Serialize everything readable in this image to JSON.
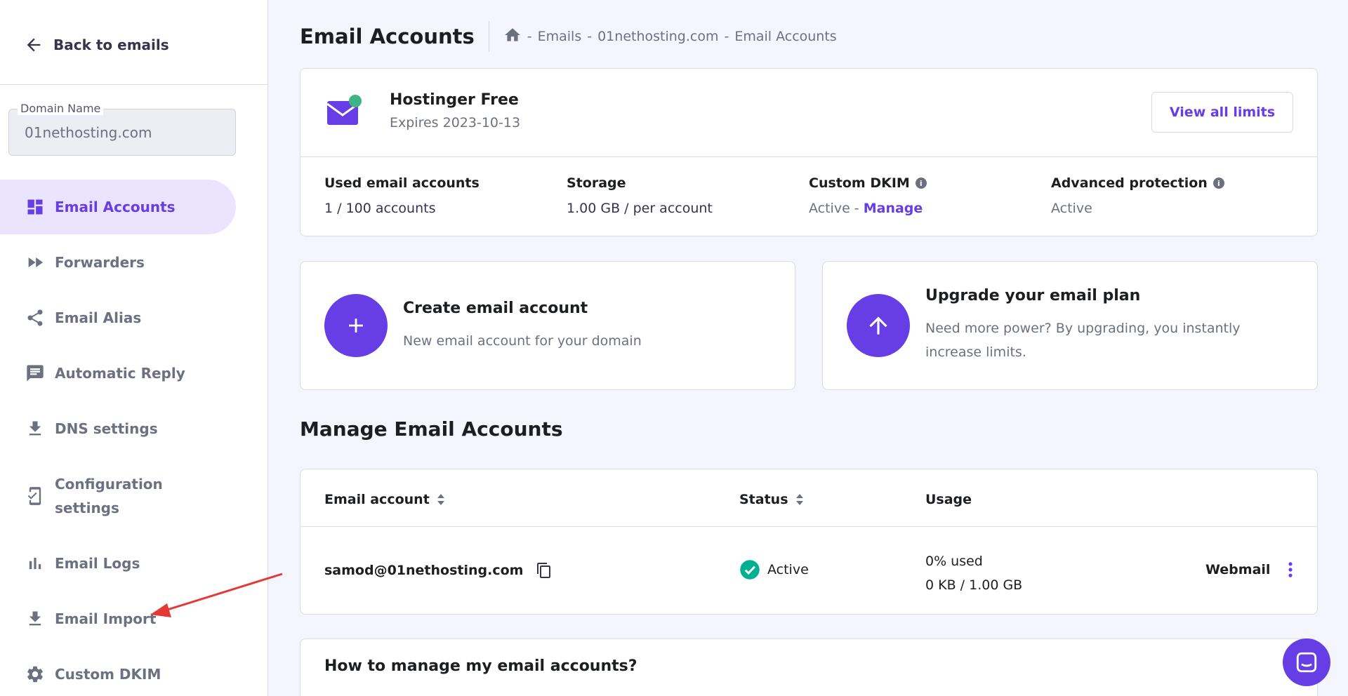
{
  "sidebar": {
    "back_label": "Back to emails",
    "domain_field": {
      "legend": "Domain Name",
      "value": "01nethosting.com"
    },
    "items": [
      {
        "label": "Email Accounts",
        "icon": "dashboard-icon",
        "active": true
      },
      {
        "label": "Forwarders",
        "icon": "fast-forward-icon"
      },
      {
        "label": "Email Alias",
        "icon": "share-icon"
      },
      {
        "label": "Automatic Reply",
        "icon": "chat-bubble-icon"
      },
      {
        "label": "DNS settings",
        "icon": "download-icon"
      },
      {
        "label": "Configuration settings",
        "icon": "phone-settings-icon"
      },
      {
        "label": "Email Logs",
        "icon": "bar-chart-icon"
      },
      {
        "label": "Email Import",
        "icon": "download-icon"
      },
      {
        "label": "Custom DKIM",
        "icon": "gear-icon"
      }
    ]
  },
  "header": {
    "title": "Email Accounts",
    "breadcrumb": [
      "Emails",
      "01nethosting.com",
      "Email Accounts"
    ],
    "breadcrumb_sep": "-"
  },
  "plan": {
    "name": "Hostinger Free",
    "expires": "Expires 2023-10-13",
    "view_limits_label": "View all limits",
    "stats": {
      "used_label": "Used email accounts",
      "used_value": "1 / 100 accounts",
      "storage_label": "Storage",
      "storage_value": "1.00 GB / per account",
      "dkim_label": "Custom DKIM",
      "dkim_status": "Active -",
      "dkim_manage": "Manage",
      "adv_label": "Advanced protection",
      "adv_value": "Active"
    }
  },
  "actions": {
    "create": {
      "title": "Create email account",
      "desc": "New email account for your domain"
    },
    "upgrade": {
      "title": "Upgrade your email plan",
      "desc": "Need more power? By upgrading, you instantly increase limits."
    }
  },
  "manage": {
    "title": "Manage Email Accounts",
    "columns": {
      "account": "Email account",
      "status": "Status",
      "usage": "Usage"
    },
    "rows": [
      {
        "email": "samod@01nethosting.com",
        "status": "Active",
        "usage_pct": "0% used",
        "usage_amt": "0 KB / 1.00 GB",
        "webmail": "Webmail"
      }
    ]
  },
  "faq": {
    "title": "How to manage my email accounts?"
  },
  "colors": {
    "accent": "#673de6",
    "active_bg": "#ebe4ff",
    "page_bg": "#f4f5ff",
    "success": "#00b090",
    "annotation": "#e53935"
  }
}
